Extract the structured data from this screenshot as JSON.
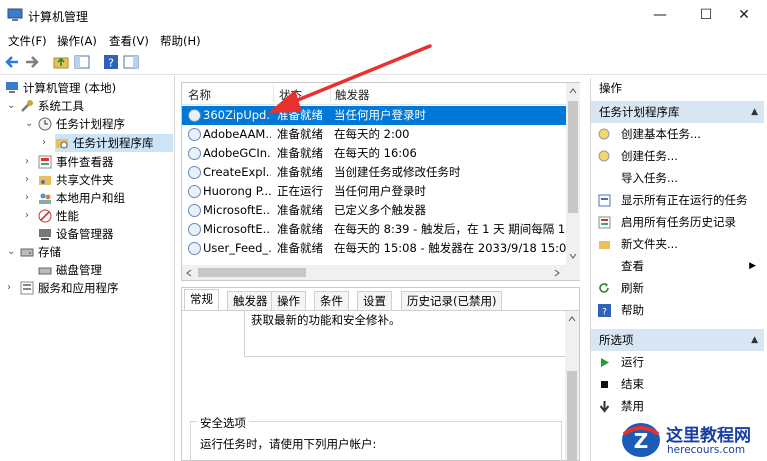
{
  "window": {
    "title": "计算机管理",
    "minimize": "—",
    "maximize": "☐",
    "close": "✕"
  },
  "menu": [
    "文件(F)",
    "操作(A)",
    "查看(V)",
    "帮助(H)"
  ],
  "tree": {
    "root": "计算机管理 (本地)",
    "system_tools": "系统工具",
    "task_scheduler": "任务计划程序",
    "task_scheduler_lib": "任务计划程序库",
    "event_viewer": "事件查看器",
    "shared_folders": "共享文件夹",
    "local_users": "本地用户和组",
    "performance": "性能",
    "device_manager": "设备管理器",
    "storage": "存储",
    "disk_mgmt": "磁盘管理",
    "services_apps": "服务和应用程序"
  },
  "list": {
    "headers": [
      "名称",
      "状态",
      "触发器"
    ],
    "rows": [
      {
        "name": "360ZipUpd...",
        "status": "准备就绪",
        "trigger": "当任何用户登录时"
      },
      {
        "name": "AdobeAAM...",
        "status": "准备就绪",
        "trigger": "在每天的 2:00"
      },
      {
        "name": "AdobeGCIn...",
        "status": "准备就绪",
        "trigger": "在每天的 16:06"
      },
      {
        "name": "CreateExpl...",
        "status": "准备就绪",
        "trigger": "当创建任务或修改任务时"
      },
      {
        "name": "Huorong P...",
        "status": "正在运行",
        "trigger": "当任何用户登录时"
      },
      {
        "name": "MicrosoftE...",
        "status": "准备就绪",
        "trigger": "已定义多个触发器"
      },
      {
        "name": "MicrosoftE...",
        "status": "准备就绪",
        "trigger": "在每天的 8:39 - 触发后，在 1 天 期间每隔 1 小"
      },
      {
        "name": "User_Feed_...",
        "status": "准备就绪",
        "trigger": "在每天的 15:08 - 触发器在 2033/9/18 15:08:5"
      }
    ]
  },
  "detail": {
    "tabs": [
      "常规",
      "触发器",
      "操作",
      "条件",
      "设置",
      "历史记录(已禁用)"
    ],
    "description": "获取最新的功能和安全修补。",
    "security_title": "安全选项",
    "security_line": "运行任务时，请使用下列用户帐户:"
  },
  "actions": {
    "header": "操作",
    "group1": "任务计划程序库",
    "items1": [
      "创建基本任务...",
      "创建任务...",
      "导入任务...",
      "显示所有正在运行的任务",
      "启用所有任务历史记录",
      "新文件夹...",
      "查看",
      "刷新",
      "帮助"
    ],
    "group2": "所选项",
    "items2": [
      "运行",
      "结束",
      "禁用"
    ]
  },
  "watermark": {
    "title": "这里教程网",
    "url": "herecours.com"
  },
  "colors": {
    "selection": "#0078d7",
    "group_bg": "#d8e6f3",
    "arrow": "#e8312f"
  }
}
